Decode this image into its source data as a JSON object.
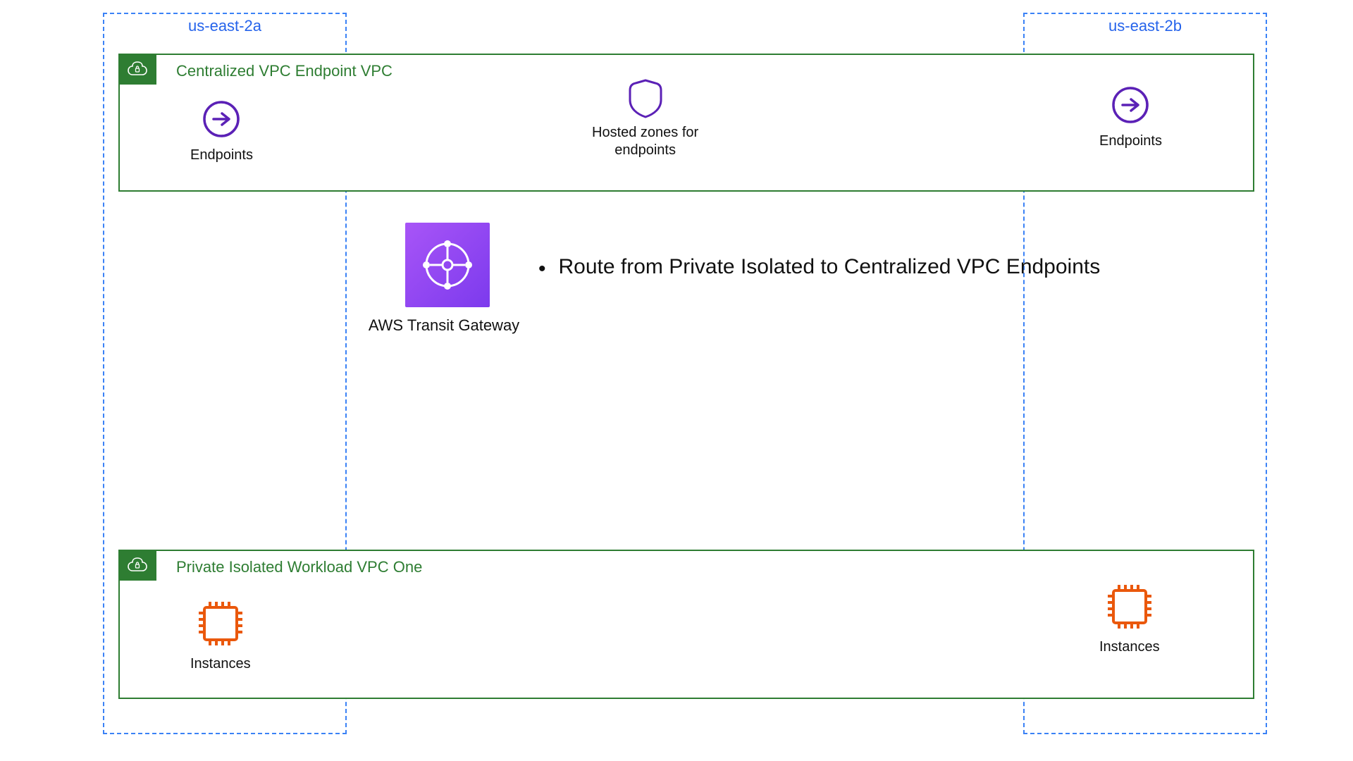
{
  "availability_zones": {
    "left": {
      "label": "us-east-2a"
    },
    "right": {
      "label": "us-east-2b"
    }
  },
  "vpcs": {
    "centralized": {
      "title": "Centralized VPC Endpoint VPC",
      "left_node_label": "Endpoints",
      "center_node_label": "Hosted zones for\nendpoints",
      "right_node_label": "Endpoints"
    },
    "isolated": {
      "title": "Private Isolated Workload VPC One",
      "left_node_label": "Instances",
      "right_node_label": "Instances"
    }
  },
  "transit_gateway": {
    "label": "AWS Transit Gateway"
  },
  "bullets": [
    "Route from Private Isolated to Centralized VPC Endpoints"
  ]
}
